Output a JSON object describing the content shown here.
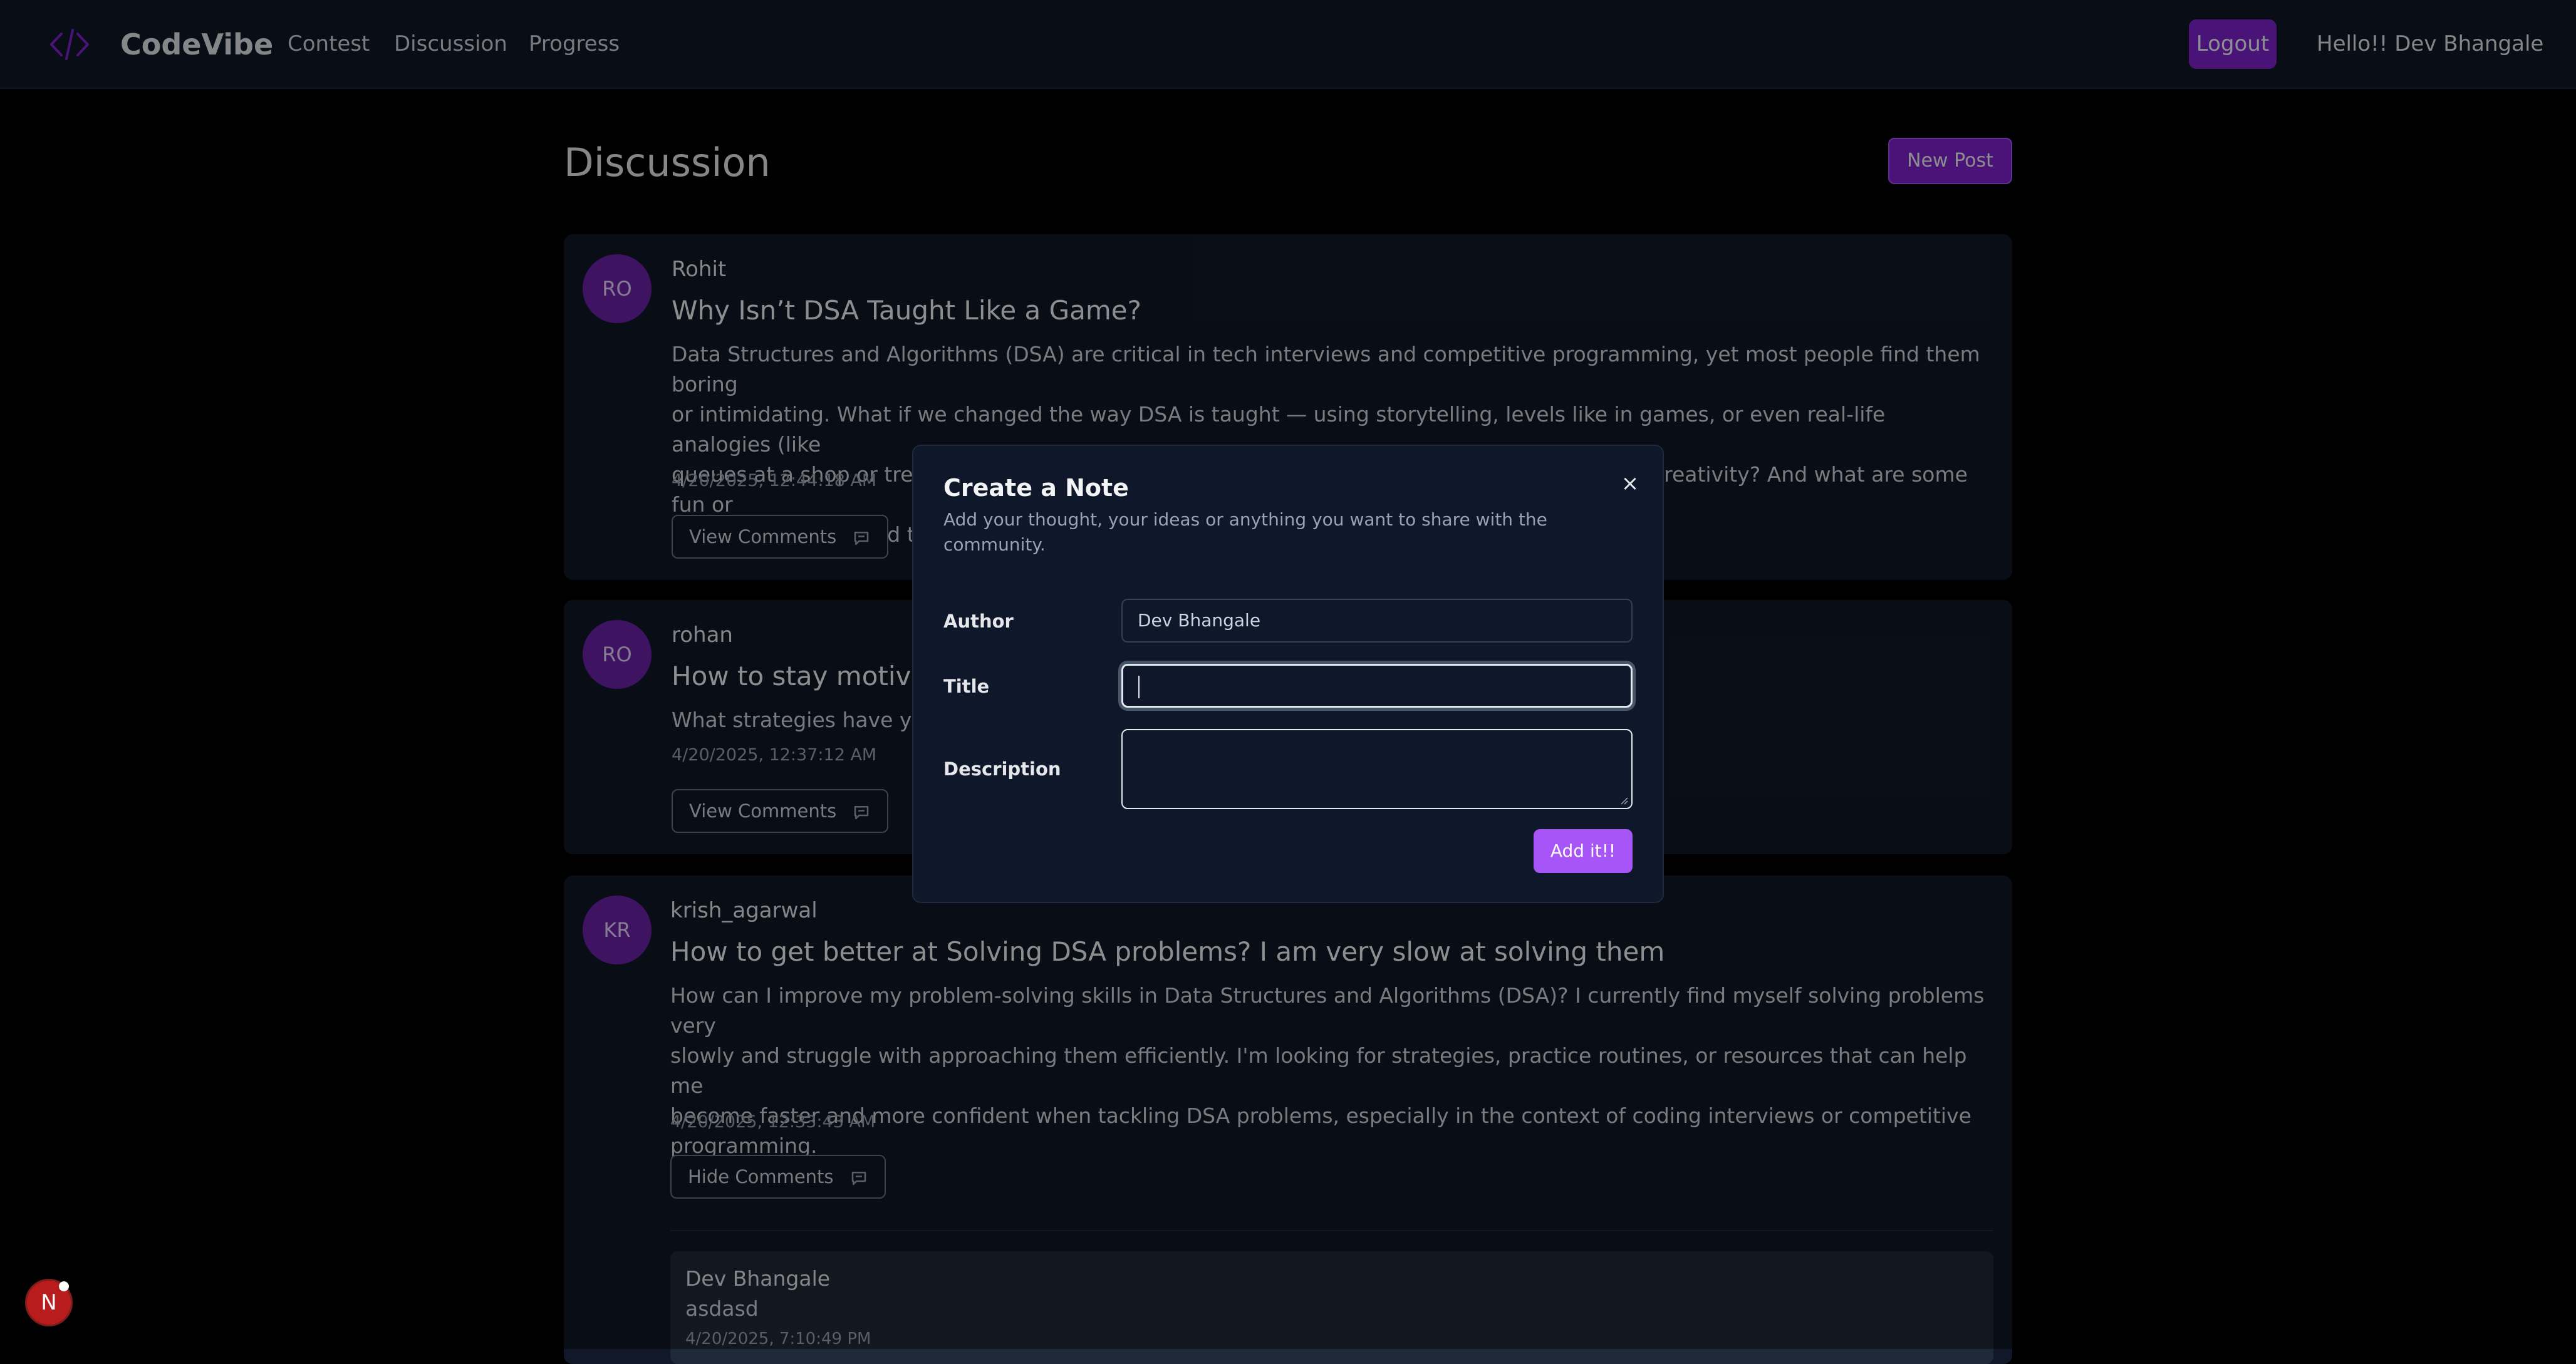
{
  "nav": {
    "brand": "CodeVibe",
    "links": [
      "Contest",
      "Discussion",
      "Progress"
    ],
    "logout_label": "Logout",
    "greeting": "Hello!! Dev Bhangale"
  },
  "page": {
    "title": "Discussion",
    "new_post_label": "New Post"
  },
  "posts": [
    {
      "initials": "RO",
      "author": "Rohit",
      "title": "Why Isn’t DSA Taught Like a Game?",
      "body_lines": [
        "Data Structures and Algorithms (DSA) are critical in tech interviews and competitive programming, yet most people find them boring",
        "or intimidating. What if we changed the way DSA is taught — using storytelling, levels like in games, or even real-life analogies (like",
        "queues at a shop or trees as family charts)? Why do you think traditional DSA education lacks creativity? And what are some fun or",
        "unique ways we could teach and learn DSA to make it more engaging and memorable?"
      ],
      "date": "4/20/2025, 12:44:18 AM",
      "comments_label": "View Comments"
    },
    {
      "initials": "RO",
      "author": "rohan",
      "title": "How to stay motivated",
      "body_lines": [
        "What strategies have you used to stay motivated and consistent with your DSA practice?"
      ],
      "date": "4/20/2025, 12:37:12 AM",
      "comments_label": "View Comments"
    },
    {
      "initials": "KR",
      "author": "krish_agarwal",
      "title": "How to get better at Solving DSA problems? I am very slow at solving them",
      "body_lines": [
        "How can I improve my problem-solving skills in Data Structures and Algorithms (DSA)? I currently find myself solving problems very",
        "slowly and struggle with approaching them efficiently. I'm looking for strategies, practice routines, or resources that can help me",
        "become faster and more confident when tackling DSA problems, especially in the context of coding interviews or competitive",
        "programming."
      ],
      "date": "4/20/2025, 12:33:43 AM",
      "comments_label": "Hide Comments",
      "comment": {
        "author": "Dev Bhangale",
        "text": "asdasd",
        "date": "4/20/2025, 7:10:49 PM"
      }
    }
  ],
  "modal": {
    "title": "Create a Note",
    "description_lines": [
      "Add your thought, your ideas or anything you want to share with the",
      "community."
    ],
    "close_glyph": "×",
    "author_label": "Author",
    "author_value": "Dev Bhangale",
    "title_label": "Title",
    "title_value": "",
    "description_label": "Description",
    "submit_label": "Add it!!"
  },
  "floating_badge": {
    "letter": "N"
  },
  "colors": {
    "accent": "#a855f7",
    "accent_dark": "#7e22ce",
    "avatar": "#6b21a8",
    "card": "#111827",
    "background": "#000000"
  }
}
